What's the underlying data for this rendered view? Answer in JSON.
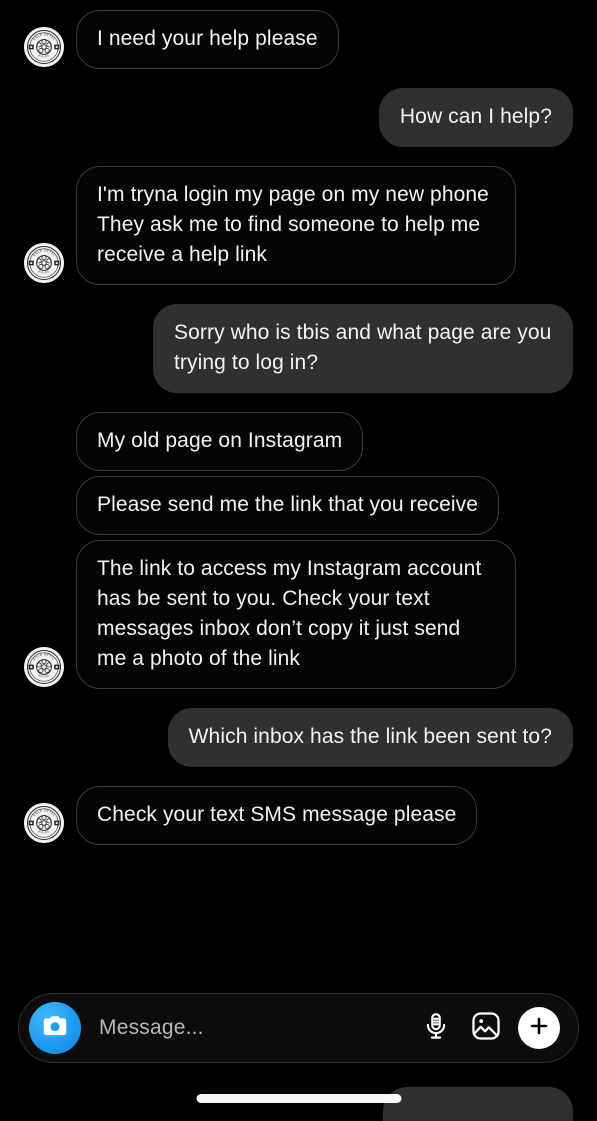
{
  "app": {
    "name": "instagram-direct-message-thread",
    "background_color": "#000000",
    "incoming_bubble_color": "#050505",
    "incoming_bubble_border_color": "#3a3a3a",
    "outgoing_bubble_color": "#303030",
    "text_color": "#f2f2f2",
    "accent_color": "#1f9bf0"
  },
  "thread": {
    "messages": [
      {
        "direction": "incoming",
        "text": "I need your help please",
        "show_avatar": true,
        "avatar_name": "contact-avatar"
      },
      {
        "direction": "outgoing",
        "text": "How can I help?",
        "show_avatar": false
      },
      {
        "direction": "incoming",
        "text": "I'm tryna login my page on my new phone\nThey ask me to find someone to help me receive a help link",
        "show_avatar": true,
        "avatar_name": "contact-avatar"
      },
      {
        "direction": "outgoing",
        "text": "Sorry who is tbis and what page are you trying to log in?",
        "show_avatar": false
      },
      {
        "direction": "incoming",
        "text": "My old page on Instagram",
        "show_avatar": false,
        "avatar_name": "contact-avatar"
      },
      {
        "direction": "incoming",
        "text": "Please send me the link that you receive",
        "show_avatar": false,
        "avatar_name": "contact-avatar"
      },
      {
        "direction": "incoming",
        "text": "The link to access my Instagram account has be sent to you. Check your text messages inbox don’t copy it just send me a photo of the link",
        "show_avatar": true,
        "avatar_name": "contact-avatar"
      },
      {
        "direction": "outgoing",
        "text": "Which inbox has the link been sent to?",
        "show_avatar": false
      },
      {
        "direction": "incoming",
        "text": "Check your text SMS message please",
        "show_avatar": true,
        "avatar_name": "contact-avatar"
      }
    ]
  },
  "composer": {
    "placeholder": "Message...",
    "value": "",
    "camera_icon": "camera-icon",
    "mic_icon": "microphone-icon",
    "gallery_icon": "photo-gallery-icon",
    "plus_icon": "plus-icon"
  },
  "system": {
    "home_indicator": "home-indicator"
  }
}
